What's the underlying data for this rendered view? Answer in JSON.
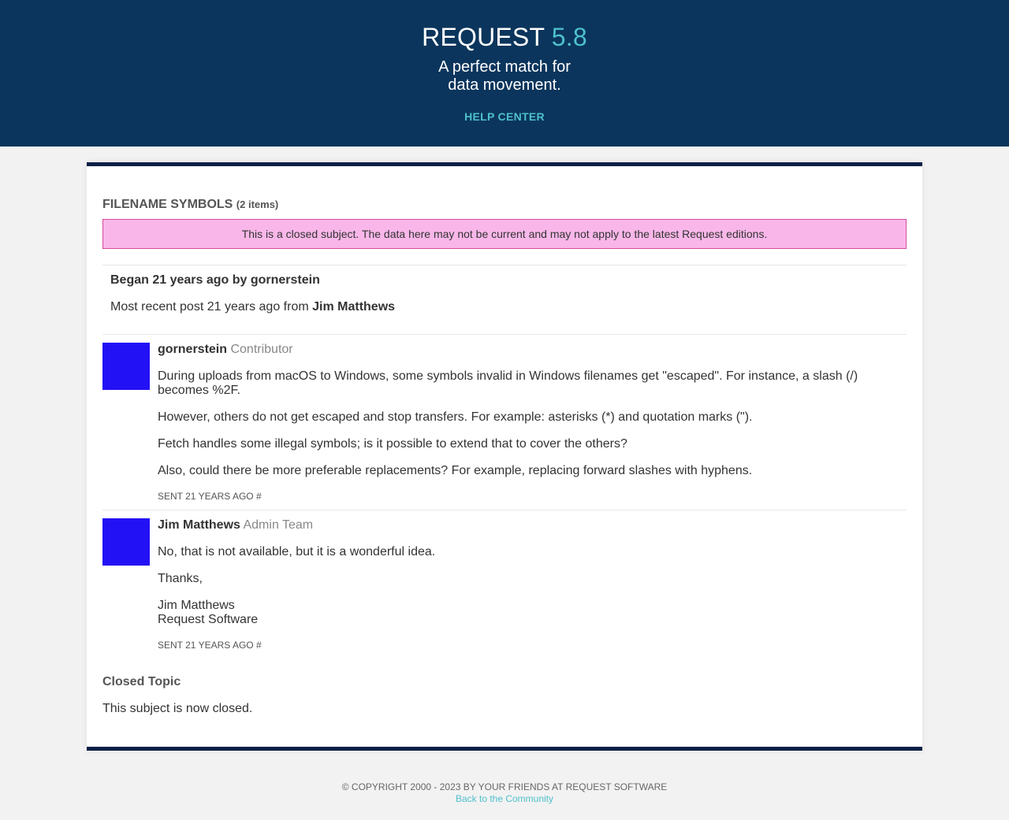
{
  "header": {
    "brand": "REQUEST",
    "version": "5.8",
    "tagline_line1": "A perfect match for",
    "tagline_line2": "data movement.",
    "help_link": "HELP CENTER",
    "bg_color": "#0b355c",
    "accent_color": "#4ec0cc"
  },
  "topic": {
    "title": "FILENAME SYMBOLS",
    "count": "(2 items)",
    "notice": "This is a closed subject. The data here may not be current and may not apply to the latest Request editions.",
    "began": "Began 21 years ago by gornerstein",
    "recent_prefix": "Most recent post 21 years ago from",
    "recent_author": "Jim Matthews"
  },
  "posts": [
    {
      "author": "gornerstein",
      "role": "Contributor",
      "paragraphs": [
        "During uploads from macOS to Windows, some symbols invalid in Windows filenames get \"escaped\". For instance, a slash (/) becomes %2F.",
        "However, others do not get escaped and stop transfers. For example: asterisks (*) and quotation marks (\").",
        "Fetch handles some illegal symbols; is it possible to extend that to cover the others?",
        "Also, could there be more preferable replacements? For example, replacing forward slashes with hyphens."
      ],
      "sent": "SENT 21 YEARS AGO #"
    },
    {
      "author": "Jim Matthews",
      "role": "Admin Team",
      "paragraphs": [
        "No, that is not available, but it is a wonderful idea.",
        "Thanks,"
      ],
      "sig_line1": "Jim Matthews",
      "sig_line2": "Request Software",
      "sent": "SENT 21 YEARS AGO #"
    }
  ],
  "closed": {
    "title": "Closed Topic",
    "text": "This subject is now closed."
  },
  "footer": {
    "copyright": "© COPYRIGHT 2000 - 2023 BY YOUR FRIENDS AT REQUEST SOFTWARE",
    "back_link": "Back to the Community"
  }
}
